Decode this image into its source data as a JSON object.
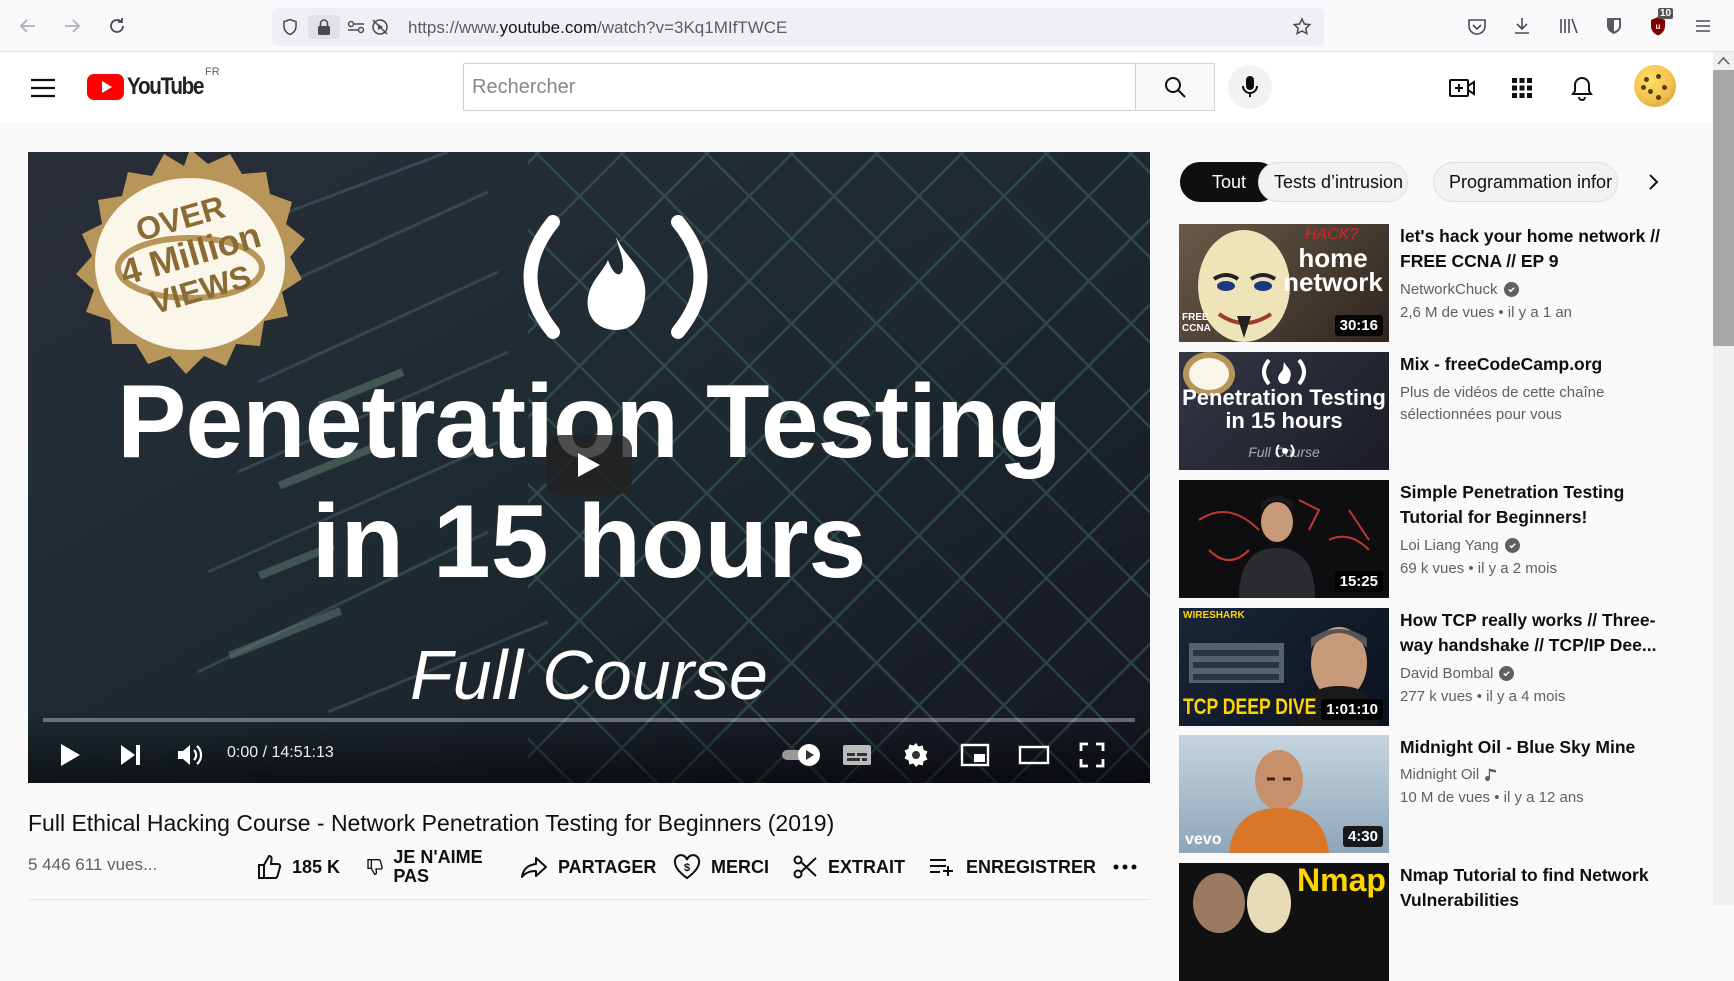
{
  "browser": {
    "url_prefix": "https://www.",
    "url_domain": "youtube.com",
    "url_path": "/watch?v=3Kq1MIfTWCE",
    "extension_badge": "10"
  },
  "header": {
    "logo_text": "YouTube",
    "country": "FR",
    "search_placeholder": "Rechercher"
  },
  "player": {
    "badge_over": "OVER",
    "badge_million": "4 Million",
    "badge_views": "VIEWS",
    "thumb_title_1": "Penetration Testing",
    "thumb_title_2": "in 15 hours",
    "thumb_subtitle": "Full Course",
    "time": "0:00 / 14:51:13",
    "progress": 0
  },
  "video": {
    "title": "Full Ethical Hacking Course - Network Penetration Testing for Beginners (2019)",
    "views": "5 446 611 vues...",
    "like_count": "185 K",
    "dislike_label": "JE N'AIME PAS",
    "share_label": "PARTAGER",
    "thanks_label": "MERCI",
    "clip_label": "EXTRAIT",
    "save_label": "ENREGISTRER"
  },
  "chips": [
    {
      "label": "Tout"
    },
    {
      "label": "Tests d’intrusion"
    },
    {
      "label": "Programmation infor"
    }
  ],
  "recommendations": [
    {
      "title": "let's hack your home network // FREE CCNA // EP 9",
      "channel": "NetworkChuck",
      "meta": "2,6 M de vues • il y a 1 an",
      "duration": "30:16",
      "thumb_text_1": "HACK?",
      "thumb_text_2": "home",
      "thumb_text_3": "network",
      "thumb_text_4": "FREE CCNA"
    },
    {
      "title": "Mix - freeCodeCamp.org",
      "desc": "Plus de vidéos de cette chaîne sélectionnées pour vous",
      "thumb_text_1": "Penetration Testing",
      "thumb_text_2": "in 15 hours",
      "thumb_text_3": "Full Course"
    },
    {
      "title": "Simple Penetration Testing Tutorial for Beginners!",
      "channel": "Loi Liang Yang",
      "meta": "69 k vues • il y a 2 mois",
      "duration": "15:25"
    },
    {
      "title": "How TCP really works // Three-way handshake // TCP/IP Dee...",
      "channel": "David Bombal",
      "meta": "277 k vues • il y a 4 mois",
      "duration": "1:01:10",
      "thumb_text_1": "TCP DEEP DIVE",
      "thumb_text_2": "WIRESHARK"
    },
    {
      "title": "Midnight Oil - Blue Sky Mine",
      "channel": "Midnight Oil",
      "meta": "10 M de vues • il y a 12 ans",
      "duration": "4:30",
      "thumb_text_1": "vevo"
    },
    {
      "title": "Nmap Tutorial to find Network Vulnerabilities",
      "thumb_text_1": "Nmap"
    }
  ]
}
